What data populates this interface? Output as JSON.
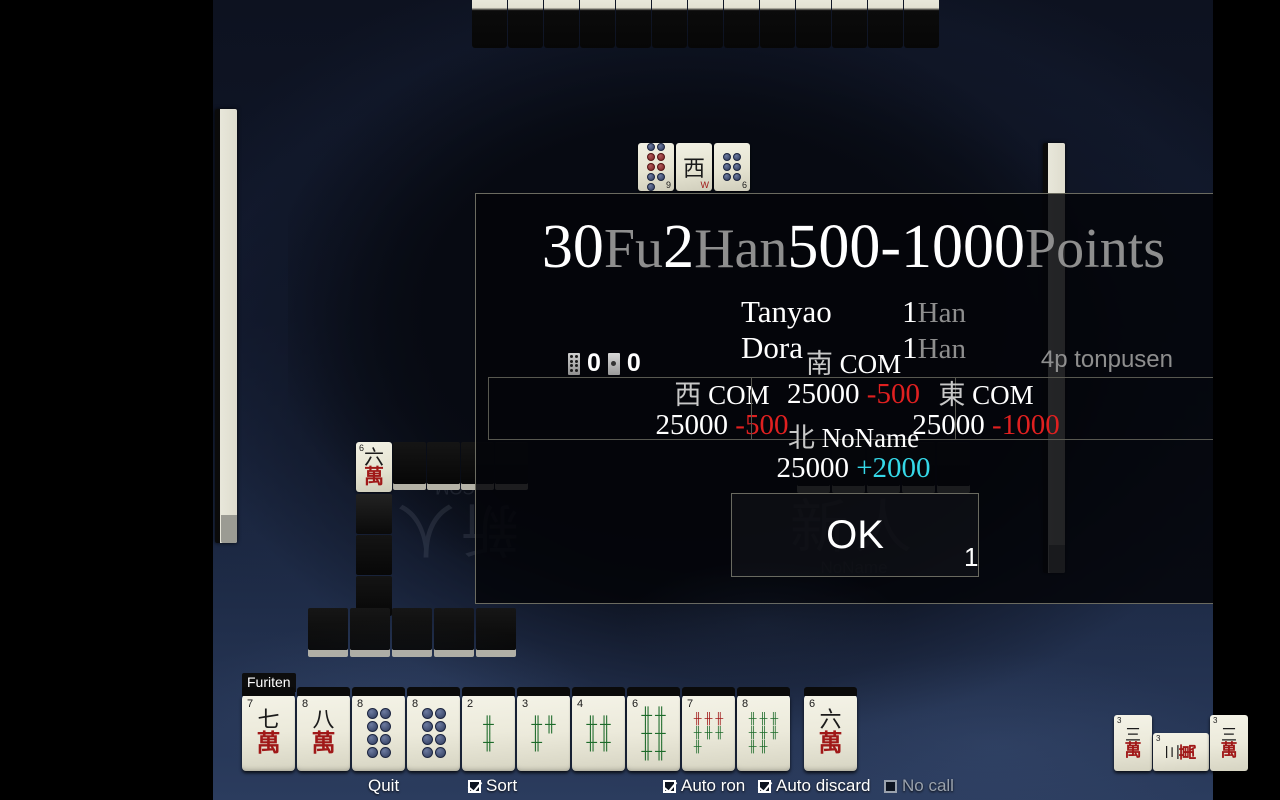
{
  "result": {
    "headline": {
      "fu_value": "30",
      "fu_unit": "Fu",
      "han_value": "2",
      "han_unit": "Han",
      "payment": "500-1000",
      "points_unit": "Points"
    },
    "yaku": [
      {
        "name": "Tanyao",
        "han": "1",
        "unit": "Han"
      },
      {
        "name": "Dora",
        "han": "1",
        "unit": "Han"
      }
    ],
    "sticks": {
      "hundred": "0",
      "thousand": "0"
    },
    "mode_label": "4p tonpusen",
    "players": [
      {
        "key": "west",
        "wind": "西",
        "name": "COM",
        "score": "25000",
        "delta": "-500",
        "delta_sign": "minus"
      },
      {
        "key": "south",
        "wind": "南",
        "name": "COM",
        "score": "25000",
        "delta": "-500",
        "delta_sign": "minus"
      },
      {
        "key": "east",
        "wind": "東",
        "name": "COM",
        "score": "25000",
        "delta": "-1000",
        "delta_sign": "minus"
      },
      {
        "key": "north",
        "wind": "北",
        "name": "NoName",
        "score": "25000",
        "delta": "+2000",
        "delta_sign": "plus"
      }
    ],
    "ok_label": "OK",
    "ok_count": "1"
  },
  "board": {
    "furiten_label": "Furiten",
    "rank_watermark": {
      "kanji": "新人",
      "name": "NoName"
    },
    "rank_watermark_left": {
      "kanji": "新人",
      "name": "COM"
    },
    "dora_indicators": [
      {
        "suit": "pin",
        "value": "9",
        "label": "9"
      },
      {
        "suit": "honor",
        "value": "W",
        "label": "W",
        "glyph": "西"
      },
      {
        "suit": "pin",
        "value": "6",
        "label": "6"
      }
    ],
    "hand": [
      {
        "suit": "man",
        "value": "7",
        "top": "七",
        "bottom": "萬"
      },
      {
        "suit": "man",
        "value": "8",
        "top": "八",
        "bottom": "萬"
      },
      {
        "suit": "pin",
        "value": "8",
        "top": "",
        "bottom": ""
      },
      {
        "suit": "pin",
        "value": "8",
        "top": "",
        "bottom": ""
      },
      {
        "suit": "sou",
        "value": "2",
        "top": "",
        "bottom": ""
      },
      {
        "suit": "sou",
        "value": "3",
        "top": "",
        "bottom": ""
      },
      {
        "suit": "sou",
        "value": "4",
        "top": "",
        "bottom": ""
      },
      {
        "suit": "sou",
        "value": "6",
        "top": "",
        "bottom": ""
      },
      {
        "suit": "sou",
        "value": "7",
        "top": "",
        "bottom": ""
      },
      {
        "suit": "sou",
        "value": "8",
        "top": "",
        "bottom": ""
      },
      {
        "suit": "man",
        "value": "6",
        "top": "六",
        "bottom": "萬",
        "drawn": true
      }
    ],
    "meld": [
      {
        "suit": "man",
        "value": "3",
        "top": "三",
        "bottom": "萬",
        "rotated": false
      },
      {
        "suit": "man",
        "value": "3",
        "top": "三",
        "bottom": "萬",
        "rotated": true
      },
      {
        "suit": "man",
        "value": "3",
        "top": "三",
        "bottom": "萬",
        "rotated": false
      }
    ],
    "discard_top": {
      "suit": "man",
      "value": "6",
      "top": "六",
      "bottom": "萬"
    }
  },
  "controls": [
    {
      "id": "quit",
      "label": "Quit",
      "type": "button",
      "checked": false,
      "enabled": true
    },
    {
      "id": "sort",
      "label": "Sort",
      "type": "checkbox",
      "checked": true,
      "enabled": true
    },
    {
      "id": "auto-ron",
      "label": "Auto ron",
      "type": "checkbox",
      "checked": true,
      "enabled": true
    },
    {
      "id": "auto-discard",
      "label": "Auto discard",
      "type": "checkbox",
      "checked": true,
      "enabled": true
    },
    {
      "id": "no-call",
      "label": "No call",
      "type": "checkbox",
      "checked": false,
      "enabled": false
    }
  ],
  "colors": {
    "gain": "#35d8e8",
    "loss": "#e02020",
    "dim_text": "#8e8e8e",
    "man_red": "#a01818",
    "sou_green": "#1d6b2a"
  }
}
